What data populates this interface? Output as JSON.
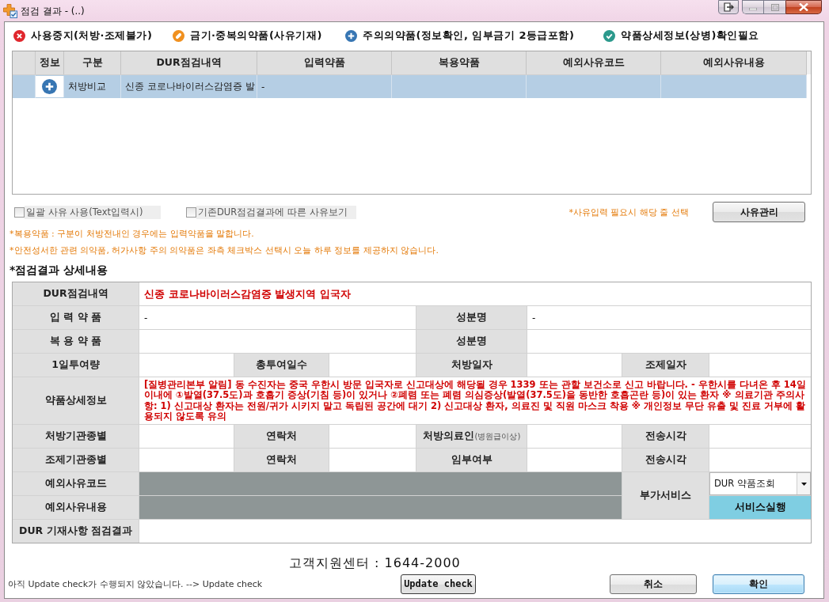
{
  "window": {
    "title": "점검 결과 - (..)"
  },
  "legend": [
    {
      "kind": "stop",
      "label": "사용중지(처방·조제불가)"
    },
    {
      "kind": "pill",
      "label": "금기·중복의약품(사유기재)"
    },
    {
      "kind": "plus",
      "label": "주의의약품(정보확인, 임부금기 2등급포함)"
    },
    {
      "kind": "check",
      "label": "약품상세정보(상병)확인필요"
    }
  ],
  "results_table": {
    "columns": [
      "정보",
      "구분",
      "DUR점검내역",
      "입력약품",
      "복용약품",
      "예외사유코드",
      "예외사유내용"
    ],
    "rows": [
      {
        "selected": true,
        "kind": "plus",
        "category": "처방비교",
        "dur_item": "신종 코로나바이러스감염증 발",
        "input_drug": "-"
      }
    ]
  },
  "options": {
    "checkboxes": [
      {
        "label": "일괄 사유 사용(Text입력시)",
        "checked": false
      },
      {
        "label": "기존DUR점검결과에 따른 사유보기",
        "checked": false
      }
    ],
    "hint": "*사유입력 필요시 해당 줄 선택",
    "button": "사유관리"
  },
  "notes": [
    "*복용약품 : 구분이 처방전내인 경우에는 입력약품을 말합니다.",
    "*안전성서한 관련 의약품, 허가사항 주의 의약품은 좌측 체크박스 선택시 오늘 하루 정보를 제공하지 않습니다."
  ],
  "detail": {
    "heading": "*점검결과 상세내용",
    "rows": [
      {
        "kind": "wide",
        "label": "DUR점검내역",
        "value": "신종 코로나바이러스감염증 발생지역 입국자"
      },
      {
        "kind": "pair",
        "cells": [
          {
            "label": "입 력 약 품",
            "value": "-"
          },
          {
            "label": "성분명",
            "value": "-"
          }
        ]
      },
      {
        "kind": "pair",
        "cells": [
          {
            "label": "복 용 약 품"
          },
          {
            "label": "성분명"
          }
        ]
      },
      {
        "kind": "quad",
        "cells": [
          {
            "label": "1일투여량"
          },
          {
            "label": "총투여일수"
          },
          {
            "label": "처방일자"
          },
          {
            "label": "조제일자"
          }
        ]
      },
      {
        "kind": "tall",
        "label": "약품상세정보",
        "value": "[질병관리본부 알림] 동 수진자는 중국 우한시 방문 입국자로 신고대상에 해당될 경우 1339 또는 관할 보건소로 신고 바랍니다. - 우한시를 다녀온 후 14일 이내에 ①발열(37.5도)과 호흡기 증상(기침 등)이 있거나 ②폐렴 또는 폐렴 의심증상(발열(37.5도)을 동반한 호흡곤란 등)이 있는 환자 ※ 의료기관 주의사항: 1) 신고대상 환자는 전원/귀가 시키지 말고 독립된 공간에 대기 2) 신고대상 환자, 의료진 및 직원 마스크 착용 ※ 개인정보 무단 유출 및 진료 거부에 활용되지 않도록 유의"
      },
      {
        "kind": "quad",
        "cells": [
          {
            "label": "처방기관종별"
          },
          {
            "label": "연락처"
          },
          {
            "label": "처방의료인",
            "note": "(병원급이상)"
          },
          {
            "label": "전송시각"
          }
        ]
      },
      {
        "kind": "quad",
        "cells": [
          {
            "label": "조제기관종별"
          },
          {
            "label": "연락처"
          },
          {
            "label": "임부여부"
          },
          {
            "label": "전송시각"
          }
        ]
      }
    ],
    "exception_rows": [
      {
        "label": "예외사유코드"
      },
      {
        "label": "예외사유내용"
      }
    ],
    "service": {
      "label": "부가서비스",
      "selected_option": "DUR 약품조회",
      "run_button": "서비스실행"
    },
    "record_check": {
      "label": "DUR 기재사항 점검결과"
    }
  },
  "support": "고객지원센터 : 1644-2000",
  "status": {
    "message": "아직 Update check가 수행되지 않았습니다. --> Update check",
    "button": "Update check"
  },
  "buttons": [
    {
      "label": "취소",
      "default": false
    },
    {
      "label": "확인",
      "default": true
    }
  ]
}
